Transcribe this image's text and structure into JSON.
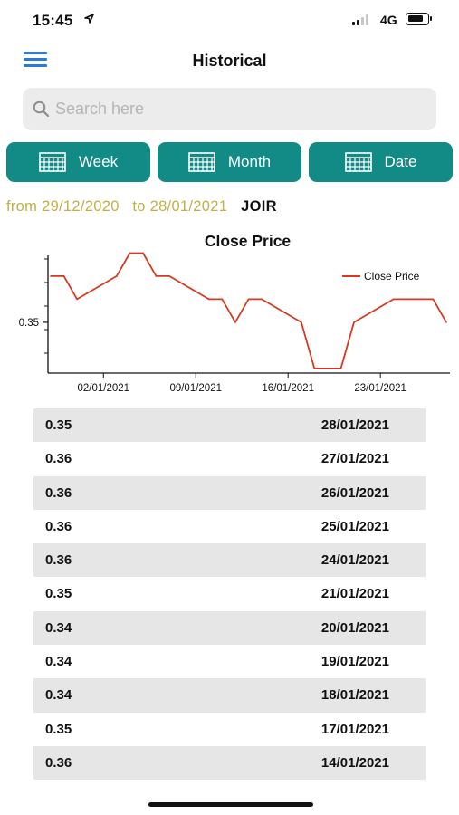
{
  "status_bar": {
    "time": "15:45",
    "network": "4G"
  },
  "header": {
    "title": "Historical"
  },
  "search": {
    "placeholder": "Search here",
    "value": ""
  },
  "tabs": [
    {
      "label": "Week"
    },
    {
      "label": "Month"
    },
    {
      "label": "Date"
    }
  ],
  "range": {
    "from_word": "from",
    "from_date": "29/12/2020",
    "to_word": "to",
    "to_date": "28/01/2021",
    "ticker": "JOIR"
  },
  "colors": {
    "accent": "#128a85",
    "range_text": "#c2b046",
    "line": "#d63a22",
    "row_shade": "#e6e6e6",
    "menu": "#2a7bd8"
  },
  "chart_data": {
    "type": "line",
    "title": "Close Price",
    "xlabel": "",
    "ylabel": "",
    "x_ticks": [
      "02/01/2021",
      "09/01/2021",
      "16/01/2021",
      "23/01/2021"
    ],
    "y_ticks": [
      {
        "label": "0.35",
        "value": 0.35
      }
    ],
    "ylim": [
      0.339,
      0.3645
    ],
    "legend": "top-right",
    "grid": false,
    "series": [
      {
        "name": "Close Price",
        "x": [
          "29/12/2020",
          "30/12/2020",
          "31/12/2020",
          "03/01/2021",
          "04/01/2021",
          "05/01/2021",
          "06/01/2021",
          "07/01/2021",
          "10/01/2021",
          "11/01/2021",
          "12/01/2021",
          "13/01/2021",
          "14/01/2021",
          "17/01/2021",
          "18/01/2021",
          "19/01/2021",
          "20/01/2021",
          "21/01/2021",
          "24/01/2021",
          "25/01/2021",
          "26/01/2021",
          "27/01/2021",
          "28/01/2021"
        ],
        "y": [
          0.36,
          0.36,
          0.355,
          0.36,
          0.365,
          0.365,
          0.36,
          0.36,
          0.355,
          0.355,
          0.35,
          0.355,
          0.355,
          0.35,
          0.34,
          0.34,
          0.34,
          0.35,
          0.355,
          0.355,
          0.355,
          0.355,
          0.35
        ]
      }
    ]
  },
  "table": {
    "rows": [
      {
        "price": "0.35",
        "date": "28/01/2021"
      },
      {
        "price": "0.36",
        "date": "27/01/2021"
      },
      {
        "price": "0.36",
        "date": "26/01/2021"
      },
      {
        "price": "0.36",
        "date": "25/01/2021"
      },
      {
        "price": "0.36",
        "date": "24/01/2021"
      },
      {
        "price": "0.35",
        "date": "21/01/2021"
      },
      {
        "price": "0.34",
        "date": "20/01/2021"
      },
      {
        "price": "0.34",
        "date": "19/01/2021"
      },
      {
        "price": "0.34",
        "date": "18/01/2021"
      },
      {
        "price": "0.35",
        "date": "17/01/2021"
      },
      {
        "price": "0.36",
        "date": "14/01/2021"
      }
    ]
  }
}
